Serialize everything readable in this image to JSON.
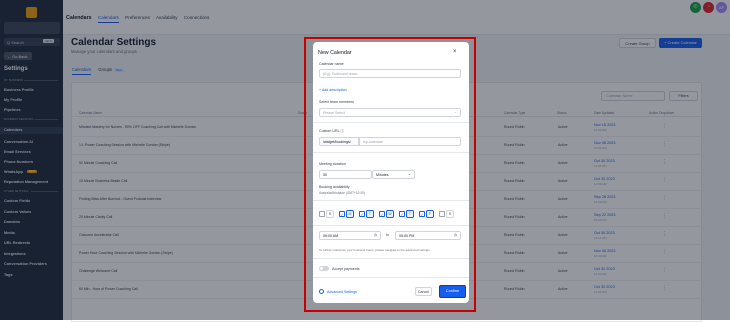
{
  "sidebar": {
    "search_placeholder": "Q Search",
    "search_shortcut": "ctrl K",
    "back_label": "← Go Back",
    "title": "Settings",
    "section_business": "MY BUSINESS",
    "section_business_services": "BUSINESS SERVICES",
    "section_other": "OTHER SETTINGS",
    "items": [
      {
        "label": "Business Profile"
      },
      {
        "label": "My Profile"
      },
      {
        "label": "Pipelines"
      },
      {
        "label": "Calendars"
      },
      {
        "label": "Conversation AI"
      },
      {
        "label": "Email Services"
      },
      {
        "label": "Phone Numbers"
      },
      {
        "label": "WhatsApp"
      },
      {
        "label": "Reputation Management"
      },
      {
        "label": "Custom Fields"
      },
      {
        "label": "Custom Values"
      },
      {
        "label": "Domains"
      },
      {
        "label": "Media"
      },
      {
        "label": "URL Redirects"
      },
      {
        "label": "Integrations"
      },
      {
        "label": "Conversation Providers"
      },
      {
        "label": "Tags"
      }
    ],
    "whatsapp_badge": "NEW"
  },
  "topbar": {
    "tabs": [
      "Calendars",
      "Calendars",
      "Preferences",
      "Availability",
      "Connections"
    ],
    "avatar_initials": "AP"
  },
  "page": {
    "title": "Calendar Settings",
    "subtitle": "Manage your calendars and groups",
    "create_group_label": "Create Group",
    "create_calendar_label": "+ Create Calendar",
    "list_tabs": [
      "Calendars",
      "Groups"
    ],
    "groups_badge": "New",
    "search_placeholder": "Calendar Name",
    "filters_label": "Filters"
  },
  "table": {
    "headers": [
      "Calendar Name",
      "Group",
      "Calendar Type",
      "Status",
      "Date Updated",
      "Action Dropdown"
    ],
    "rows": [
      {
        "name": "Mindset Mastery for Nurses - 50% OFF Coaching Call with Michelle Gordon",
        "type": "Round Robin",
        "status": "Active",
        "date": "Nov 15 2023",
        "time": "11:02 AM"
      },
      {
        "name": "1:1 Power Coaching Session with Michelle Gordon (Stripe)",
        "type": "Round Robin",
        "status": "Active",
        "date": "Nov 08 2023",
        "time": "10:41 AM"
      },
      {
        "name": "50 Minute Coaching Call",
        "type": "Round Robin",
        "status": "Active",
        "date": "Oct 30 2023",
        "time": "11:26 AM"
      },
      {
        "name": "15 Minute Business Bestie Call",
        "type": "Round Robin",
        "status": "Active",
        "date": "Oct 30 2023",
        "time": "11:09 AM"
      },
      {
        "name": "Finding Bliss After Burnout - Guest Podcast Interview",
        "type": "Round Robin",
        "status": "Active",
        "date": "Sep 28 2023",
        "time": "12:30 PM"
      },
      {
        "name": "20 Minute Clarity Call",
        "type": "Round Robin",
        "status": "Active",
        "date": "Sep 22 2023",
        "time": "10:05 AM"
      },
      {
        "name": "Outcome Accelerator Call",
        "type": "Round Robin",
        "status": "Active",
        "date": "Oct 30 2023",
        "time": "11:14 AM"
      },
      {
        "name": "Power Hour Coaching Session with Michelle Gordon (Stripe)",
        "type": "Round Robin",
        "status": "Active",
        "date": "Nov 08 2023",
        "time": "10:43 AM"
      },
      {
        "name": "Challenge Welcome Call",
        "type": "Round Robin",
        "status": "Active",
        "date": "Oct 30 2023",
        "time": "11:20 AM"
      },
      {
        "name": "60 Min - Hour of Power Coaching Call",
        "type": "Round Robin",
        "status": "Active",
        "date": "Oct 30 2023",
        "time": "11:23 AM"
      }
    ]
  },
  "dialog": {
    "title": "New Calendar",
    "close": "×",
    "calendar_name_label": "Calendar name",
    "calendar_name_placeholder": "(Eg): Outbound reach",
    "add_description": "+ Add description",
    "select_team_label": "Select team members",
    "select_team_placeholder": "Please Select",
    "custom_url_label": "Custom URL ⓘ",
    "custom_url_prefix": "/widget/bookings/",
    "custom_url_placeholder": "my-calendar",
    "duration_label": "Meeting duration",
    "duration_value": "30",
    "duration_unit": "Minutes",
    "availability_label": "Booking availability",
    "timezone": "Australia/Brisbane (GMT+10:00)",
    "days": [
      {
        "label": "S",
        "checked": false
      },
      {
        "label": "M",
        "checked": true
      },
      {
        "label": "T",
        "checked": true
      },
      {
        "label": "W",
        "checked": true
      },
      {
        "label": "T",
        "checked": true
      },
      {
        "label": "F",
        "checked": true
      },
      {
        "label": "S",
        "checked": false
      }
    ],
    "start_time": "09:00 AM",
    "to_label": "to",
    "end_time": "05:00 PM",
    "note": "To further customize your business hours, please navigate to the advanced settings",
    "accept_payments": "Accept payments",
    "advanced_settings": "Advanced Settings",
    "cancel": "Cancel",
    "confirm": "Confirm"
  },
  "colors": {
    "accent": "#155eef",
    "sidebar": "#1f2a3b",
    "highlight": "#c90000",
    "active": "#22c55e"
  }
}
